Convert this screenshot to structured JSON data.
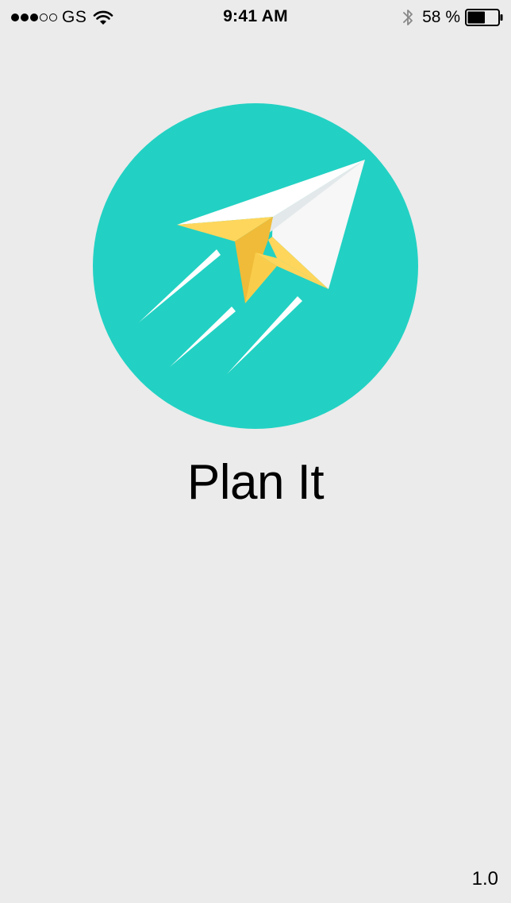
{
  "status_bar": {
    "signal_filled": 3,
    "signal_total": 5,
    "carrier": "GS",
    "time": "9:41 AM",
    "battery_percent": "58 %",
    "battery_level": 0.58,
    "icons": [
      "signal-dots-icon",
      "wifi-icon",
      "bluetooth-icon",
      "battery-icon"
    ]
  },
  "logo": {
    "icon": "paper-plane-icon",
    "circle_color": "#22d1c3",
    "plane_colors": [
      "#ffffff",
      "#ffd65c",
      "#f0bb38"
    ]
  },
  "app": {
    "name": "Plan It",
    "version": "1.0"
  }
}
